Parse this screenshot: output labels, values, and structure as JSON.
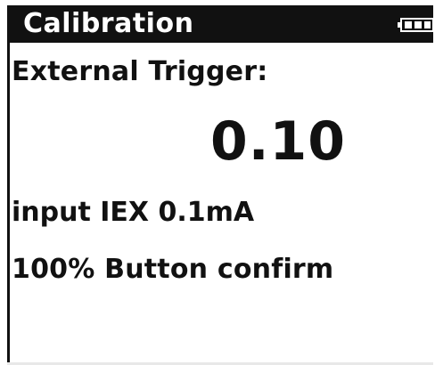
{
  "header": {
    "title": "Calibration",
    "battery_icon": "battery-icon"
  },
  "main": {
    "label": "External Trigger:",
    "value": "0.10",
    "input_line": "input IEX 0.1mA",
    "confirm_line": "100% Button confirm"
  },
  "colors": {
    "bar": "#111111",
    "background": "#ffffff",
    "text": "#111111"
  }
}
